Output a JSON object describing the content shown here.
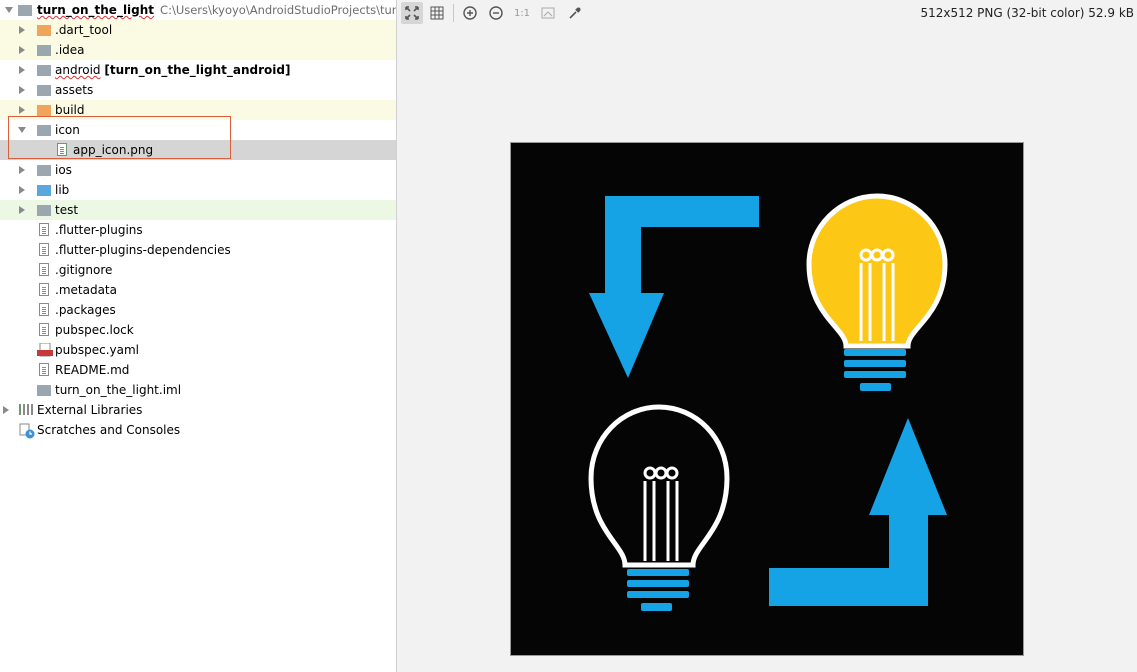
{
  "tree": {
    "root": {
      "name": "turn_on_the_light",
      "path": "C:\\Users\\kyoyo\\AndroidStudioProjects\\turn_"
    },
    "items": [
      {
        "label": ".dart_tool"
      },
      {
        "label": ".idea"
      },
      {
        "label": "android",
        "suffix": "[turn_on_the_light_android]"
      },
      {
        "label": "assets"
      },
      {
        "label": "build"
      },
      {
        "label": "icon"
      },
      {
        "label": "app_icon.png"
      },
      {
        "label": "ios"
      },
      {
        "label": "lib"
      },
      {
        "label": "test"
      },
      {
        "label": ".flutter-plugins"
      },
      {
        "label": ".flutter-plugins-dependencies"
      },
      {
        "label": ".gitignore"
      },
      {
        "label": ".metadata"
      },
      {
        "label": ".packages"
      },
      {
        "label": "pubspec.lock"
      },
      {
        "label": "pubspec.yaml"
      },
      {
        "label": "README.md"
      },
      {
        "label": "turn_on_the_light.iml"
      },
      {
        "label": "External Libraries"
      },
      {
        "label": "Scratches and Consoles"
      }
    ]
  },
  "viewer": {
    "toolbar": {
      "zoom_actual_label": "1:1"
    },
    "image_info": "512x512 PNG (32-bit color) 52.9 kB"
  },
  "colors": {
    "accent_blue": "#16a3e5",
    "bulb_yellow": "#fcc715",
    "selection_box": "#d9603b"
  }
}
